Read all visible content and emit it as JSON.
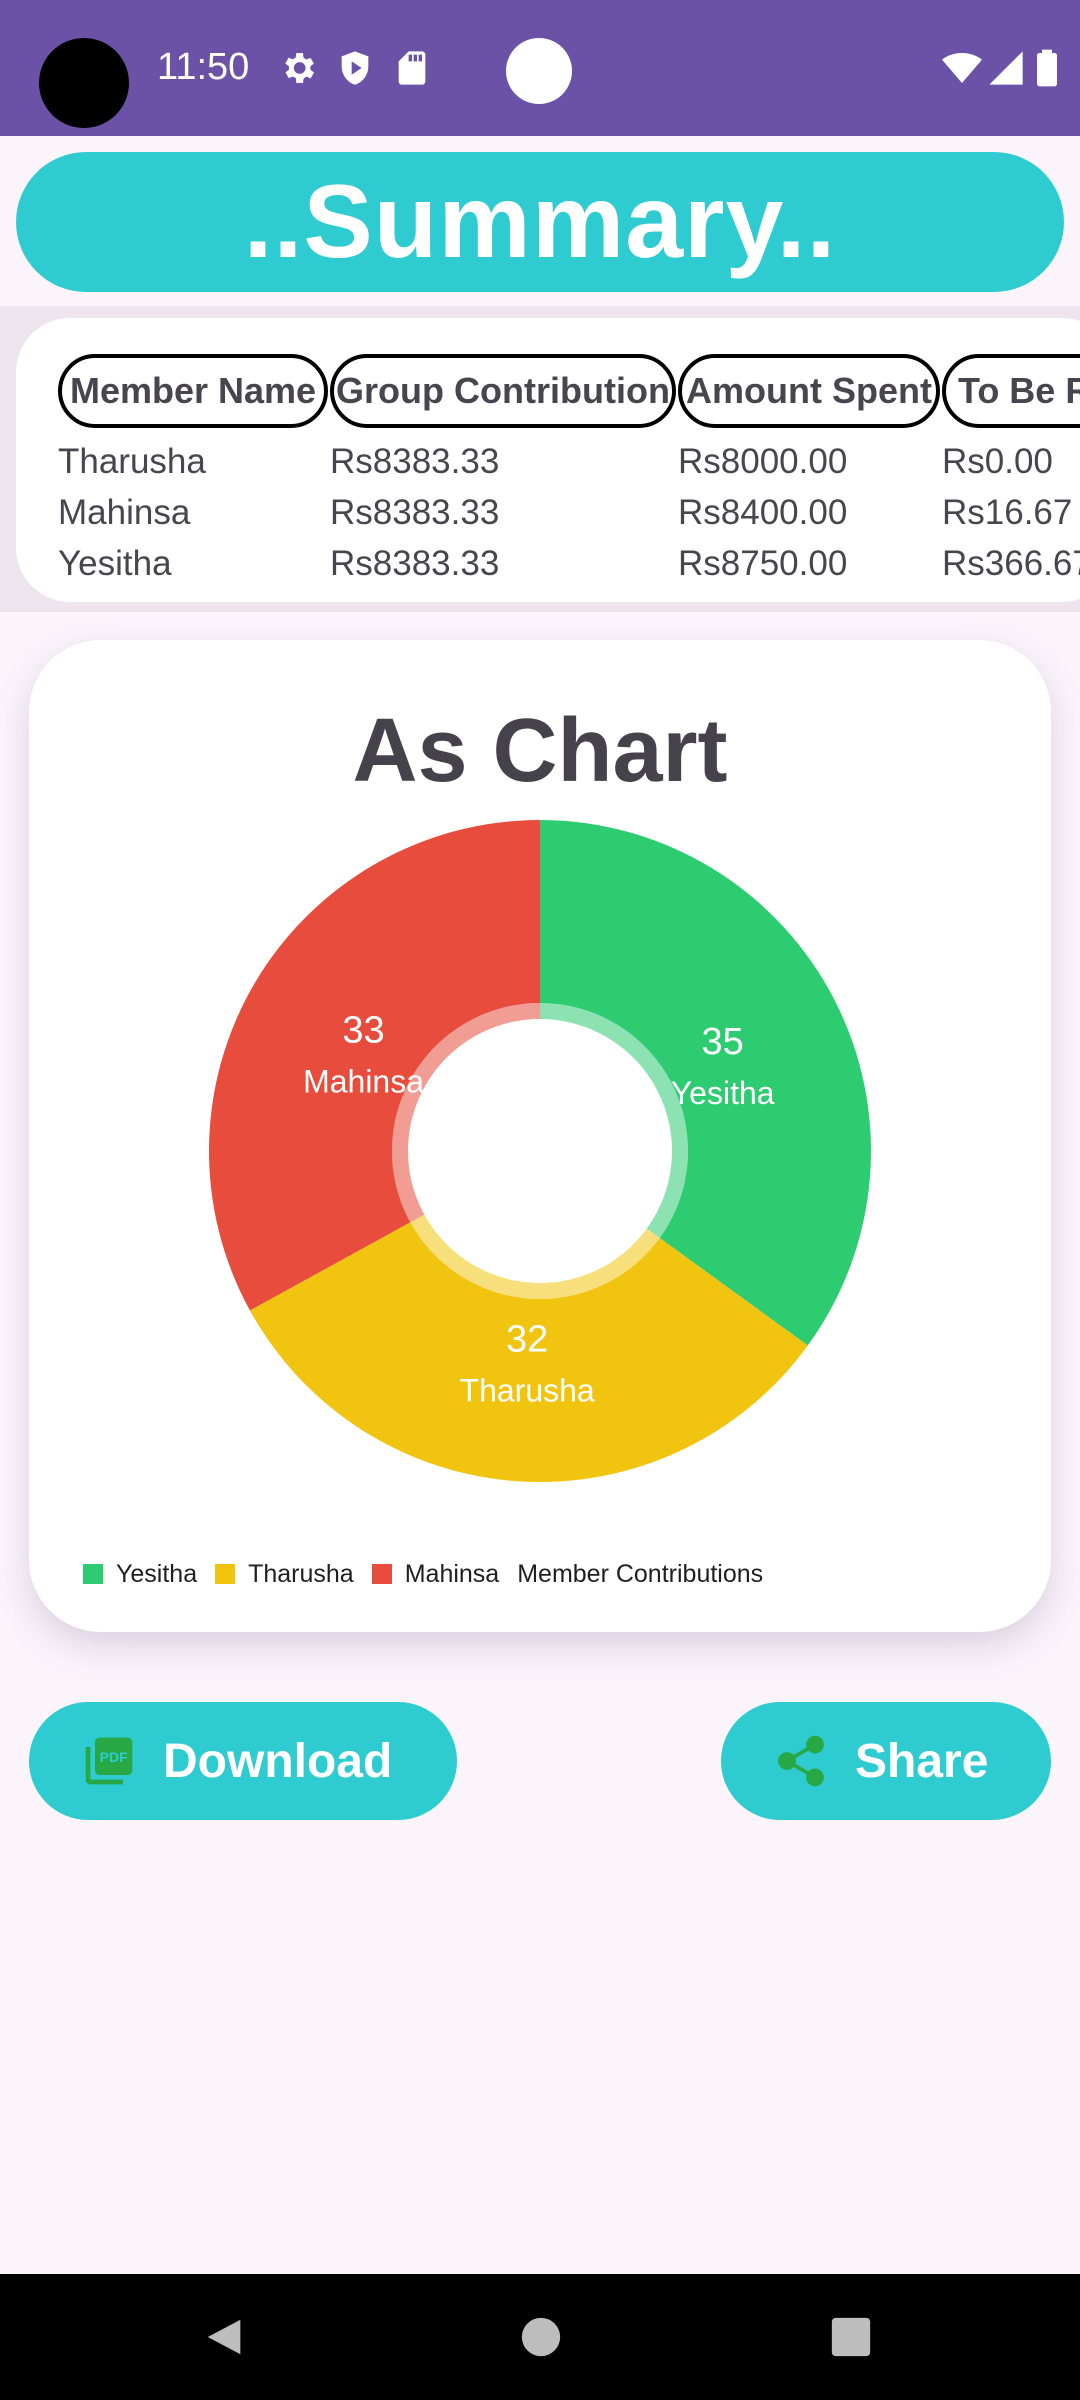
{
  "status_bar": {
    "time": "11:50",
    "left_icons": [
      "settings-icon",
      "shield-icon",
      "sd-card-icon"
    ],
    "right_icons": [
      "wifi-icon",
      "signal-icon",
      "battery-icon"
    ],
    "background": "#6b52a6"
  },
  "header": {
    "title": "..Summary..",
    "accent": "#2ecbd0"
  },
  "table": {
    "columns": [
      "Member Name",
      "Group Contribution",
      "Amount Spent",
      "To Be Re"
    ],
    "rows": [
      [
        "Tharusha",
        "Rs8383.33",
        "Rs8000.00",
        "Rs0.00"
      ],
      [
        "Mahinsa",
        "Rs8383.33",
        "Rs8400.00",
        "Rs16.67"
      ],
      [
        "Yesitha",
        "Rs8383.33",
        "Rs8750.00",
        "Rs366.67"
      ]
    ]
  },
  "chart_card": {
    "title": "As Chart"
  },
  "chart_data": {
    "type": "pie",
    "donut": true,
    "series_name": "Member Contributions",
    "slices": [
      {
        "label": "Yesitha",
        "value": 35,
        "color": "#2ecc71"
      },
      {
        "label": "Tharusha",
        "value": 32,
        "color": "#f1c40f"
      },
      {
        "label": "Mahinsa",
        "value": 33,
        "color": "#e74c3c"
      }
    ],
    "legend": [
      "Yesitha",
      "Tharusha",
      "Mahinsa"
    ],
    "legend_position": "bottom-left"
  },
  "buttons": {
    "download_label": "Download",
    "share_label": "Share",
    "download_icon": "pdf-icon",
    "share_icon": "share-icon"
  },
  "nav_bar": {
    "icons": [
      "back-icon",
      "home-icon",
      "recents-icon"
    ]
  }
}
